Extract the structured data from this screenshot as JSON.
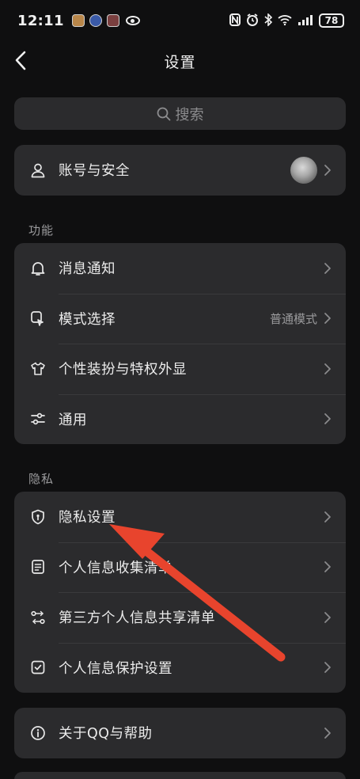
{
  "status_bar": {
    "time": "12:11",
    "battery": "78"
  },
  "header": {
    "title": "设置"
  },
  "search": {
    "label": "搜索"
  },
  "account": {
    "label": "账号与安全"
  },
  "sections": {
    "features": {
      "title": "功能",
      "items": [
        {
          "label": "消息通知",
          "icon": "bell-icon"
        },
        {
          "label": "模式选择",
          "icon": "mode-icon",
          "value": "普通模式"
        },
        {
          "label": "个性装扮与特权外显",
          "icon": "shirt-icon"
        },
        {
          "label": "通用",
          "icon": "sliders-icon"
        }
      ]
    },
    "privacy": {
      "title": "隐私",
      "items": [
        {
          "label": "隐私设置",
          "icon": "shield-icon"
        },
        {
          "label": "个人信息收集清单",
          "icon": "document-icon"
        },
        {
          "label": "第三方个人信息共享清单",
          "icon": "share-icon"
        },
        {
          "label": "个人信息保护设置",
          "icon": "checkbox-icon"
        }
      ]
    }
  },
  "about": {
    "label": "关于QQ与帮助",
    "icon": "info-icon"
  },
  "colors": {
    "background": "#0f0f10",
    "card": "#2b2b2d",
    "annotation_arrow": "#e8442d"
  }
}
